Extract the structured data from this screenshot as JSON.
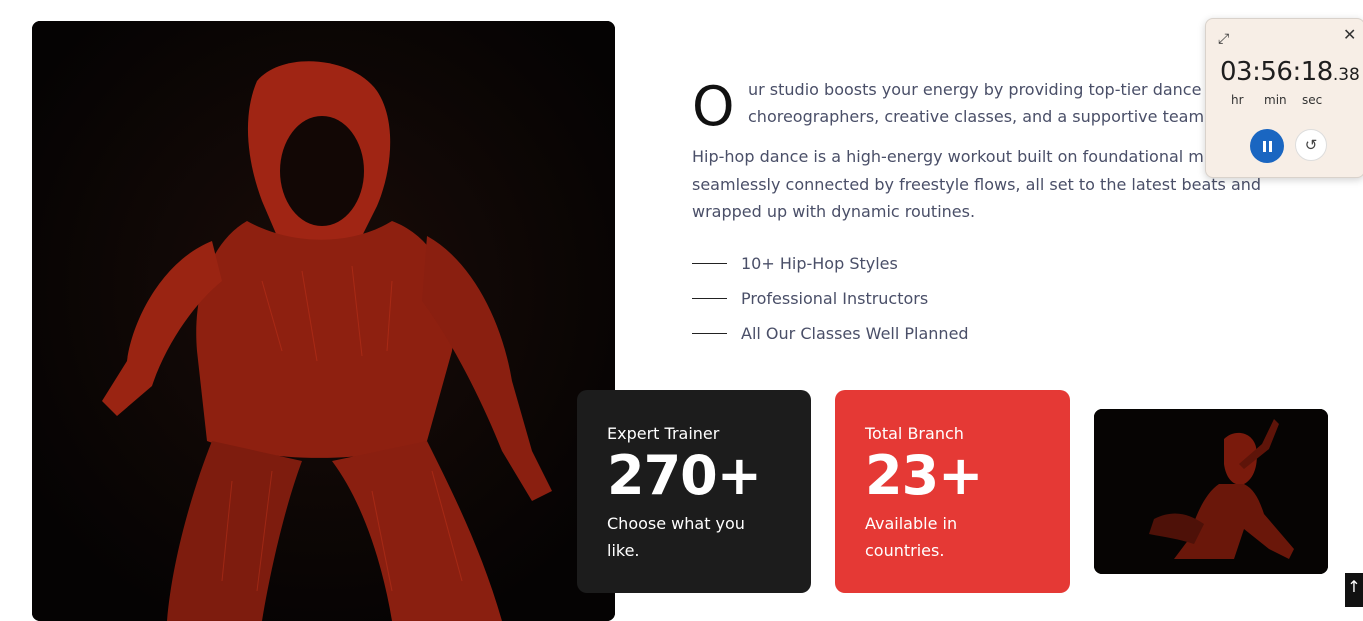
{
  "intro": {
    "dropcap": "O",
    "lead_line1": "ur studio boosts your energy by providing top-tier dance",
    "lead_line2": "choreographers, creative classes, and a supportive team",
    "body_line1": "Hip-hop dance is a high-energy workout built on foundational m",
    "body_line2": "seamlessly connected by freestyle flows, all set to the latest beats and",
    "body_line3": "wrapped up with dynamic routines."
  },
  "features": [
    {
      "label": "10+ Hip-Hop Styles"
    },
    {
      "label": "Professional Instructors"
    },
    {
      "label": "All Our Classes Well Planned"
    }
  ],
  "stats": {
    "trainer": {
      "title": "Expert Trainer",
      "number": "270+",
      "desc_line1": "Choose what you",
      "desc_line2": "like."
    },
    "branch": {
      "title": "Total Branch",
      "number": "23+",
      "desc_line1": "Available in",
      "desc_line2": "countries."
    }
  },
  "timer": {
    "hours": "03",
    "minutes": "56",
    "seconds": "18",
    "centiseconds": ".38",
    "sep": ":",
    "unit_hr": "hr",
    "unit_min": "min",
    "unit_sec": "sec",
    "icons": {
      "expand": "expand-icon",
      "close": "close-icon",
      "pause": "pause-icon",
      "reset": "reset-icon"
    }
  },
  "colors": {
    "accent_red": "#e53935",
    "dark_card": "#1c1c1c",
    "text_muted": "#4a4f68",
    "timer_blue": "#1a66c1"
  }
}
